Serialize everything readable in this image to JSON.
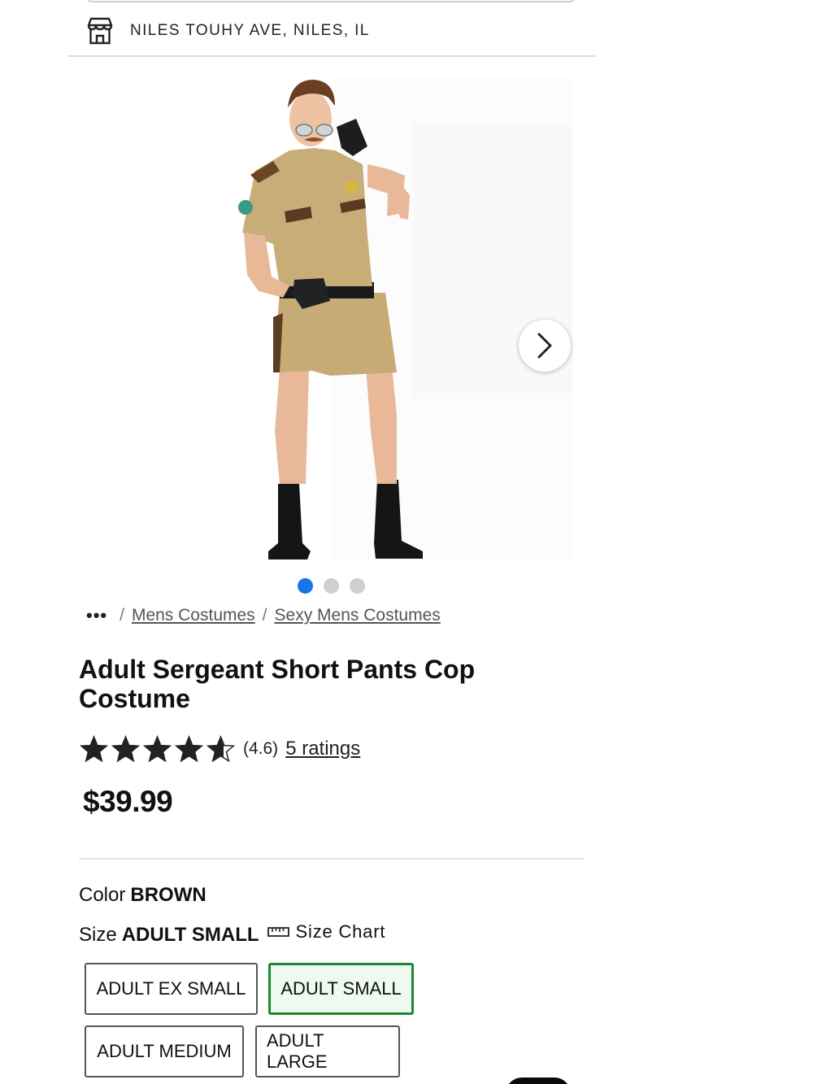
{
  "store": {
    "location": "NILES TOUHY AVE, NILES, IL",
    "icon": "store-icon"
  },
  "gallery": {
    "image_alt": "Adult Sergeant Short Pants Cop Costume",
    "next_icon": "chevron-right-icon",
    "slide_count": 3,
    "active_slide": 1
  },
  "breadcrumb": {
    "ellipsis": "•••",
    "separator": "/",
    "items": [
      "Mens Costumes",
      "Sexy Mens Costumes"
    ]
  },
  "product": {
    "title": "Adult Sergeant Short Pants Cop Costume",
    "rating": 4.6,
    "rating_text": "(4.6)",
    "ratings_link": "5 ratings",
    "price": "$39.99"
  },
  "options": {
    "color_label": "Color",
    "color_value": "BROWN",
    "size_label": "Size",
    "size_value": "ADULT SMALL",
    "size_chart_label": "Size Chart",
    "size_chart_icon": "ruler-icon",
    "sizes": [
      "ADULT EX SMALL",
      "ADULT SMALL",
      "ADULT MEDIUM",
      "ADULT LARGE"
    ],
    "selected_size": "ADULT SMALL"
  },
  "colors": {
    "accent_blue": "#1a73e8",
    "selected_green": "#1a8a2e",
    "text": "#111111"
  }
}
